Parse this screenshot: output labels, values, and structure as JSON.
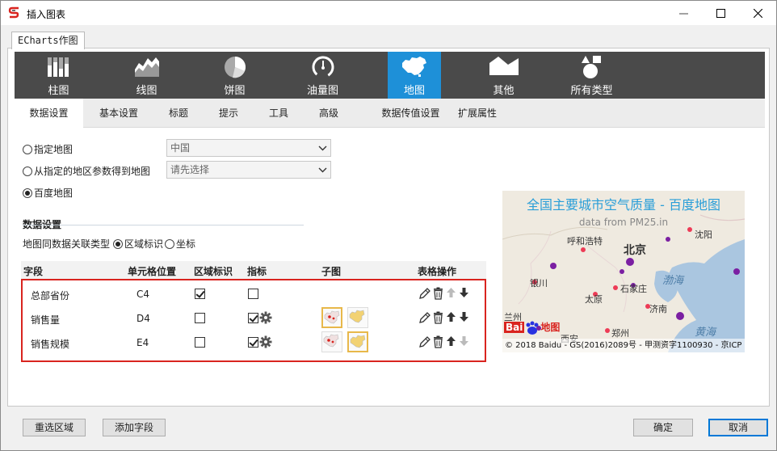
{
  "window": {
    "title": "插入图表"
  },
  "outer_tab": "ECharts作图",
  "chart_types": [
    {
      "label": "柱图",
      "icon": "bar-chart-icon"
    },
    {
      "label": "线图",
      "icon": "area-chart-icon"
    },
    {
      "label": "饼图",
      "icon": "pie-chart-icon"
    },
    {
      "label": "油量图",
      "icon": "gauge-icon"
    },
    {
      "label": "地图",
      "icon": "china-map-icon",
      "selected": true
    },
    {
      "label": "其他",
      "icon": "other-chart-icon"
    },
    {
      "label": "所有类型",
      "icon": "all-types-icon"
    }
  ],
  "sub_tabs": [
    "数据设置",
    "基本设置",
    "标题",
    "提示",
    "工具",
    "高级",
    "数据传值设置",
    "扩展属性"
  ],
  "map_source": {
    "opt1": "指定地图",
    "opt1_value": "中国",
    "opt2": "从指定的地区参数得到地图",
    "opt2_placeholder": "请先选择",
    "opt3": "百度地图",
    "selected": "百度地图"
  },
  "data_settings": {
    "title": "数据设置",
    "assoc_label": "地图同数据关联类型",
    "assoc_opt1": "区域标识",
    "assoc_opt2": "坐标",
    "assoc_selected": "区域标识"
  },
  "table": {
    "headers": [
      "字段",
      "单元格位置",
      "区域标识",
      "指标",
      "子图",
      "表格操作"
    ],
    "rows": [
      {
        "field": "总部省份",
        "cell": "C4",
        "region": true,
        "metric": false,
        "gear": false,
        "sub_selected": null,
        "up_enabled": false,
        "down_enabled": true
      },
      {
        "field": "销售量",
        "cell": "D4",
        "region": false,
        "metric": true,
        "gear": true,
        "sub_selected": 0,
        "up_enabled": true,
        "down_enabled": true
      },
      {
        "field": "销售规模",
        "cell": "E4",
        "region": false,
        "metric": true,
        "gear": true,
        "sub_selected": 1,
        "up_enabled": true,
        "down_enabled": false
      }
    ]
  },
  "preview": {
    "title": "全国主要城市空气质量 - 百度地图",
    "subtitle": "data from PM25.in",
    "cities": [
      "呼和浩特",
      "北京",
      "沈阳",
      "银川",
      "石家庄",
      "太原",
      "济南",
      "兰州",
      "郑州",
      "西安"
    ],
    "seas": [
      "渤海",
      "黄海"
    ],
    "copyright": "© 2018 Baidu - GS(2016)2089号 - 甲测资字1100930 - 京ICP",
    "logo_text": "Bai",
    "logo_text2": "地图"
  },
  "buttons": {
    "reselect": "重选区域",
    "add_field": "添加字段",
    "ok": "确定",
    "cancel": "取消"
  },
  "colors": {
    "selected_type": "#1e90d8",
    "type_bar": "#4a4a4a",
    "highlight_border": "#d9241f",
    "map_title": "#2a9ed8"
  }
}
